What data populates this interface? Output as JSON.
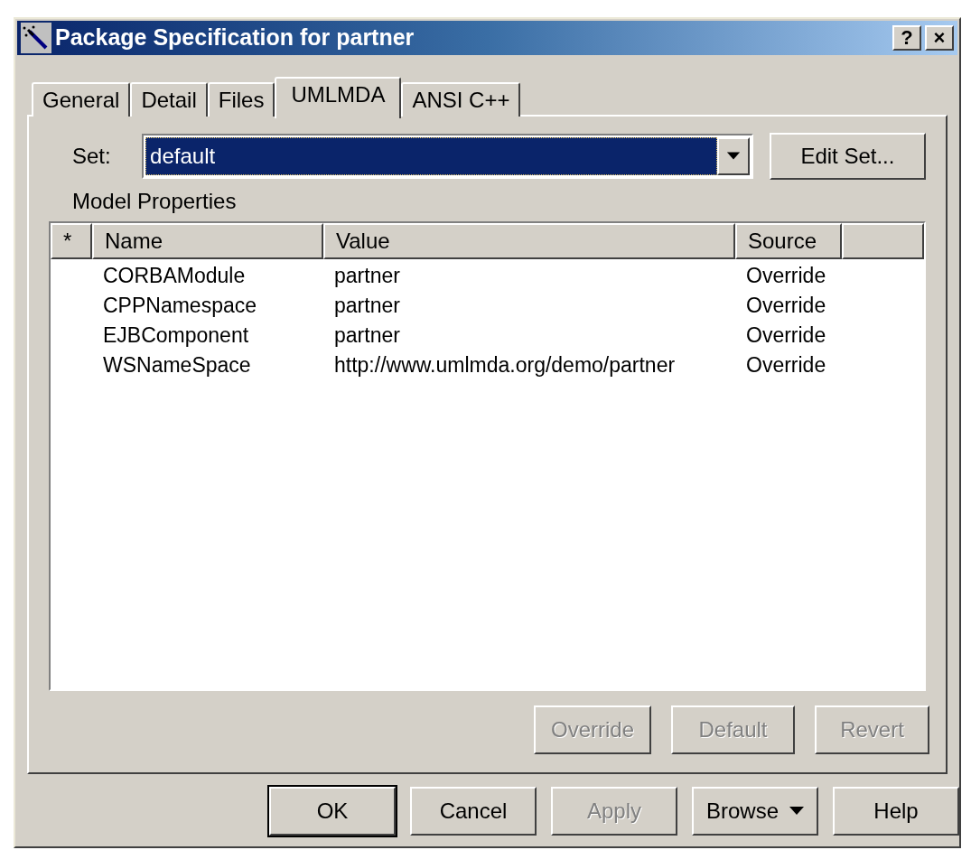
{
  "window": {
    "title": "Package Specification for partner",
    "title_buttons": [
      "?",
      "×"
    ]
  },
  "tabs": [
    {
      "label": "General",
      "selected": false
    },
    {
      "label": "Detail",
      "selected": false
    },
    {
      "label": "Files",
      "selected": false
    },
    {
      "label": "UMLMDA",
      "selected": true
    },
    {
      "label": "ANSI C++",
      "selected": false
    }
  ],
  "set": {
    "label": "Set:",
    "value": "default",
    "button": "Edit Set..."
  },
  "model_properties": {
    "label": "Model Properties",
    "columns": [
      "*",
      "Name",
      "Value",
      "Source"
    ],
    "rows": [
      {
        "name": "CORBAModule",
        "value": "partner",
        "source": "Override"
      },
      {
        "name": "CPPNamespace",
        "value": "partner",
        "source": "Override"
      },
      {
        "name": "EJBComponent",
        "value": "partner",
        "source": "Override"
      },
      {
        "name": "WSNameSpace",
        "value": "http://www.umlmda.org/demo/partner",
        "source": "Override"
      }
    ],
    "buttons": [
      {
        "label": "Override",
        "disabled": true
      },
      {
        "label": "Default",
        "disabled": true
      },
      {
        "label": "Revert",
        "disabled": true
      }
    ]
  },
  "dialog_buttons": [
    {
      "label": "OK",
      "kind": "default",
      "disabled": false
    },
    {
      "label": "Cancel",
      "kind": "plain",
      "disabled": false
    },
    {
      "label": "Apply",
      "kind": "plain",
      "disabled": true
    },
    {
      "label": "Browse",
      "kind": "menu",
      "disabled": false
    },
    {
      "label": "Help",
      "kind": "plain",
      "disabled": false
    }
  ]
}
